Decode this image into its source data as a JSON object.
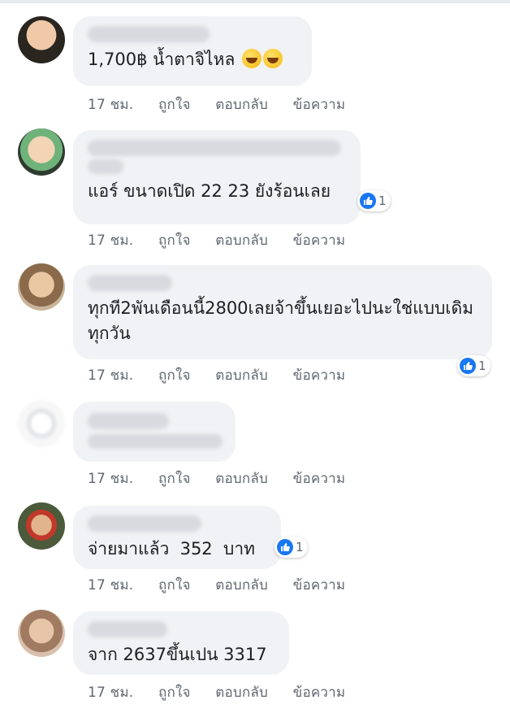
{
  "comments": [
    {
      "text": "1,700฿ น้ำตาจิไหล",
      "emojis": [
        "rofl-emoji",
        "rofl-emoji"
      ],
      "time": "17 ชม.",
      "like": "ถูกใจ",
      "reply": "ตอบกลับ",
      "message": "ข้อความ"
    },
    {
      "text": "แอร์ ขนาดเปิด 22 23 ยังร้อนเลย",
      "reactions": "1",
      "time": "17 ชม.",
      "like": "ถูกใจ",
      "reply": "ตอบกลับ",
      "message": "ข้อความ"
    },
    {
      "text": "ทุกที2พันเดือนนี้2800เลยจ้าขึ้นเยอะไปนะใช่แบบเดิมทุกวัน",
      "reactions": "1",
      "time": "17 ชม.",
      "like": "ถูกใจ",
      "reply": "ตอบกลับ",
      "message": "ข้อความ"
    },
    {
      "text": "",
      "time": "17 ชม.",
      "like": "ถูกใจ",
      "reply": "ตอบกลับ",
      "message": "ข้อความ"
    },
    {
      "text": "จ่ายมาแล้ว  352  บาท",
      "reactions": "1",
      "time": "17 ชม.",
      "like": "ถูกใจ",
      "reply": "ตอบกลับ",
      "message": "ข้อความ"
    },
    {
      "text": "จาก 2637ขึ้นเปน 3317",
      "time": "17 ชม.",
      "like": "ถูกใจ",
      "reply": "ตอบกลับ",
      "message": "ข้อความ"
    }
  ],
  "colors": {
    "bubble": "#f0f2f5",
    "like_blue": "#1877f2",
    "meta": "#606770"
  }
}
